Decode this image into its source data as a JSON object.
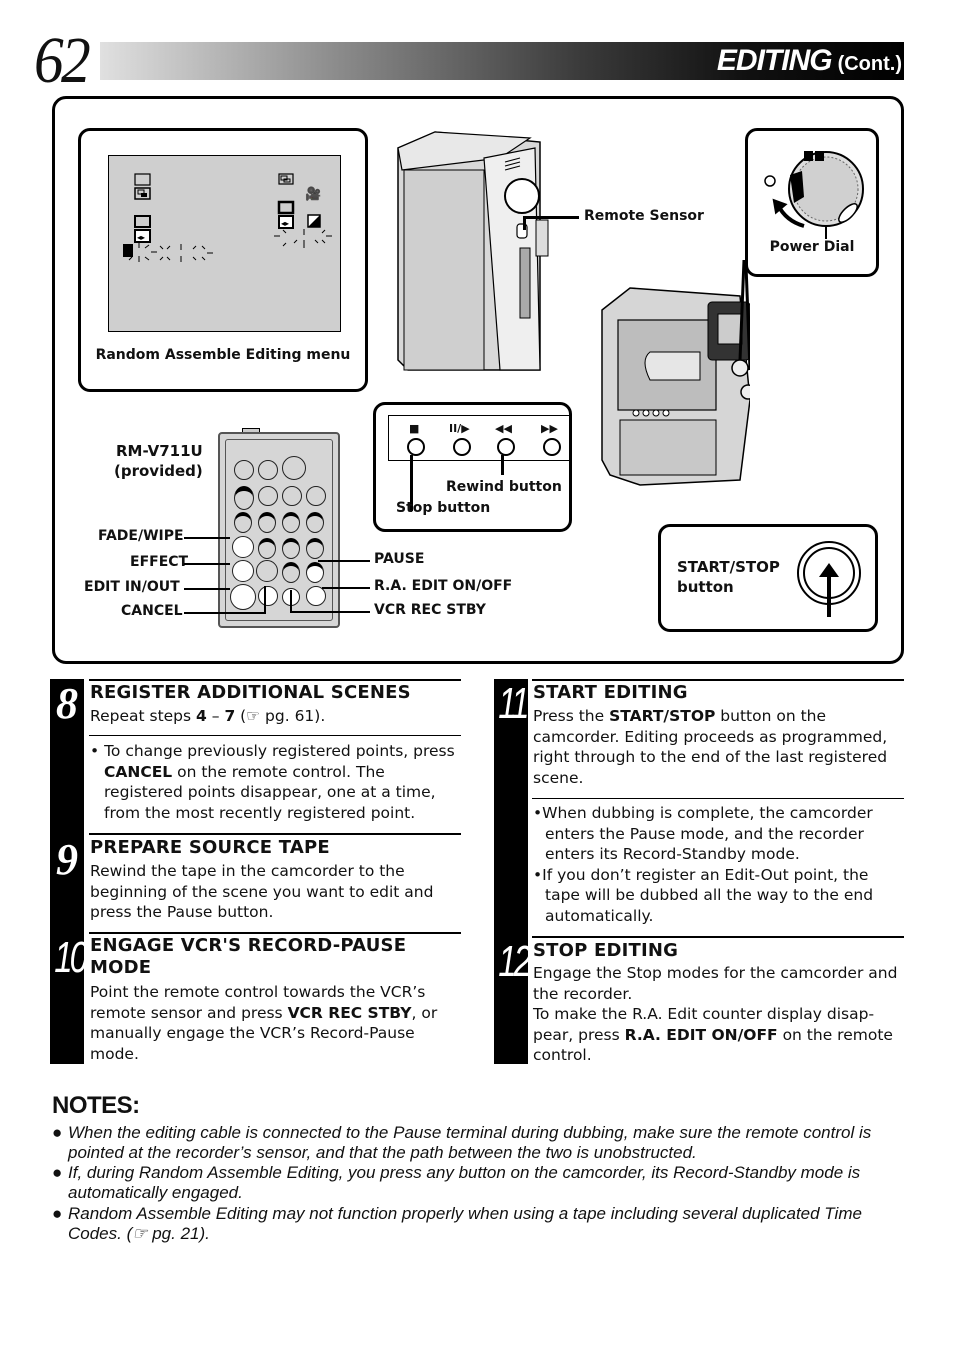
{
  "header": {
    "page_number": "62",
    "title": "EDITING",
    "title_suffix": "(Cont.)"
  },
  "diagram": {
    "menu_label": "Random Assemble Editing menu",
    "remote_sensor_label": "Remote Sensor",
    "power_dial_label": "Power Dial",
    "remote_model": "RM-V711U",
    "remote_provided": "(provided)",
    "remote_labels_left": [
      "FADE/WIPE",
      "EFFECT",
      "EDIT IN/OUT",
      "CANCEL"
    ],
    "remote_labels_right": [
      "PAUSE",
      "R.A. EDIT ON/OFF",
      "VCR REC STBY"
    ],
    "camcorder_button_glyphs": [
      "■",
      "II/▶",
      "◀◀",
      "▶▶"
    ],
    "rewind_button_label": "Rewind button",
    "stop_button_label": "Stop button",
    "start_stop_label_line1": "START/STOP",
    "start_stop_label_line2": "button"
  },
  "steps": [
    {
      "number": "8",
      "title": "REGISTER ADDITIONAL SCENES",
      "body_pre": "Repeat steps ",
      "body_bold1": "4",
      "body_mid": " – ",
      "body_bold2": "7",
      "body_post": " (☞ pg. 61).",
      "bullet_pre": "• To change previously registered points, press ",
      "bullet_bold": "CANCEL",
      "bullet_post": " on the remote control. The registered points disappear, one at a time, from the most recently registered point."
    },
    {
      "number": "9",
      "title": "PREPARE SOURCE TAPE",
      "body": "Rewind the tape in the camcorder to the beginning of the scene you want to edit and press the Pause button."
    },
    {
      "number": "10",
      "title_line1": "ENGAGE VCR'S RECORD-PAUSE",
      "title_line2": "MODE",
      "body_pre": "Point the remote control towards the VCR’s remote sensor and press ",
      "body_bold": "VCR REC STBY",
      "body_post": ", or manually engage the VCR’s Record-Pause mode."
    },
    {
      "number": "11",
      "title": "START EDITING",
      "body_pre": "Press the ",
      "body_bold": "START/STOP",
      "body_post": " button on the camcorder. Editing proceeds as programmed, right through to the end of the last registered scene.",
      "bullets": [
        "When dubbing is complete, the camcorder enters the Pause mode, and the recorder enters its Record-Standby mode.",
        "If you don’t register an Edit-Out point, the tape will be dubbed all the way to the end automatically."
      ]
    },
    {
      "number": "12",
      "title": "STOP EDITING",
      "body1": "Engage the Stop modes for the camcorder and the recorder.",
      "body2_pre": "To make the R.A. Edit counter display disap-pear, press ",
      "body2_bold": "R.A. EDIT ON/OFF",
      "body2_post": " on the remote control."
    }
  ],
  "notes": {
    "title": "NOTES:",
    "items": [
      "When the editing cable is connected to the Pause terminal during dubbing, make sure the remote control is pointed at the recorder’s sensor, and that the path between the two is unobstructed.",
      "If, during Random Assemble Editing, you press any button on the camcorder, its Record-Standby mode is automatically engaged.",
      "Random Assemble Editing may not function properly when using a tape including several duplicated Time Codes. (☞ pg. 21)."
    ]
  }
}
